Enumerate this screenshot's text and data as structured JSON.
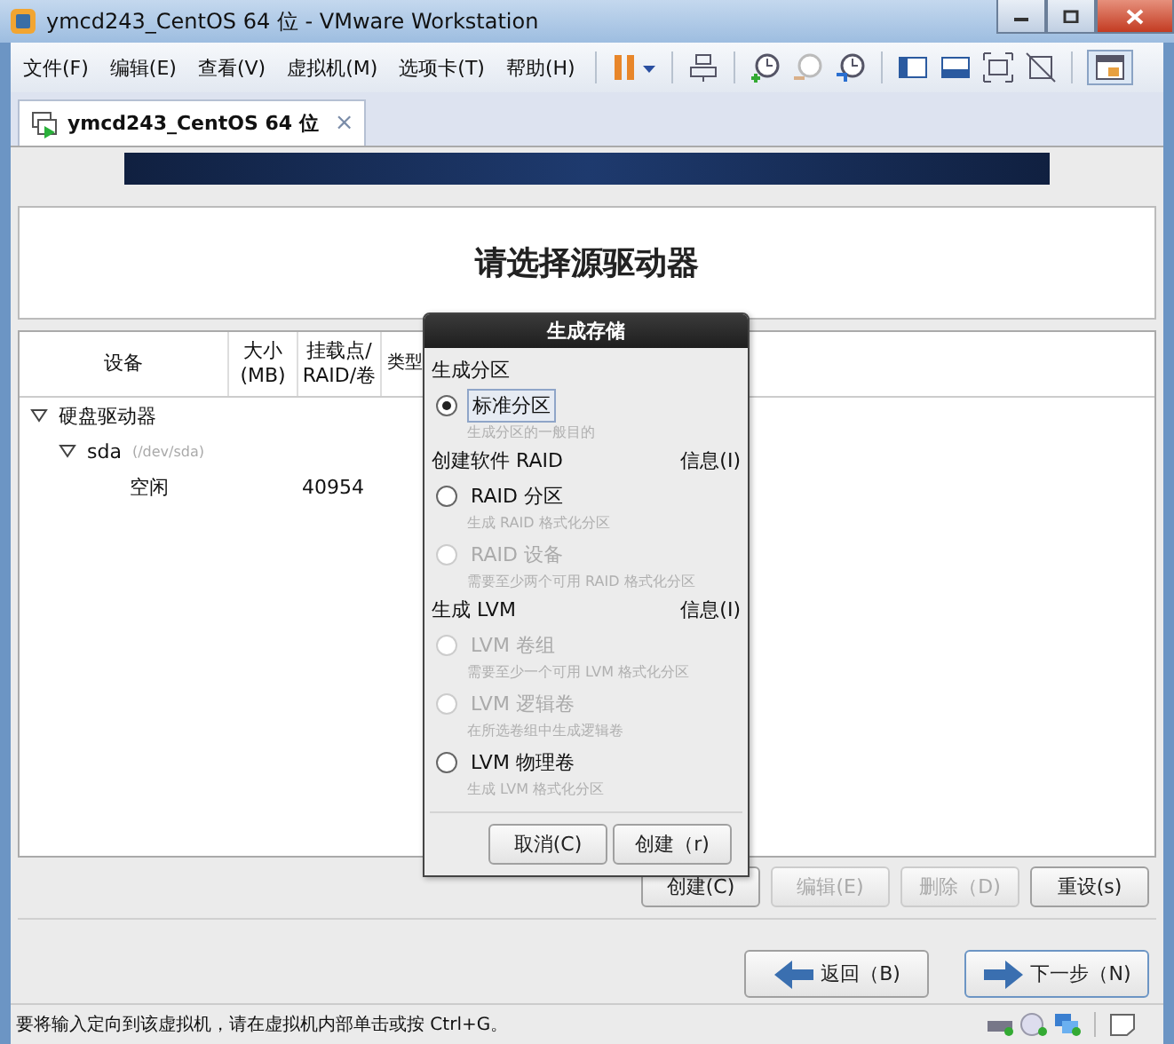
{
  "window": {
    "title": "ymcd243_CentOS 64 位 - VMware Workstation"
  },
  "menu": [
    "文件(F)",
    "编辑(E)",
    "查看(V)",
    "虚拟机(M)",
    "选项卡(T)",
    "帮助(H)"
  ],
  "tab": {
    "label": "ymcd243_CentOS 64 位",
    "close": "×"
  },
  "installer": {
    "title": "请选择源驱动器",
    "columns": [
      "设备",
      "大小\n(MB)",
      "挂载点/\nRAID/卷",
      "类型"
    ],
    "rows": [
      {
        "device": "硬盘驱动器",
        "expanded": true,
        "children": [
          {
            "device": "sda",
            "path": "(/dev/sda)",
            "expanded": true,
            "children": [
              {
                "device": "空闲",
                "size": "40954"
              }
            ]
          }
        ]
      }
    ],
    "actions": [
      {
        "label": "创建(C)",
        "disabled": false
      },
      {
        "label": "编辑(E)",
        "disabled": true
      },
      {
        "label": "删除（D)",
        "disabled": true
      },
      {
        "label": "重设(s)",
        "disabled": false
      }
    ],
    "nav": [
      {
        "label": "返回（B)",
        "kind": "back",
        "focused": false
      },
      {
        "label": "下一步（N)",
        "kind": "next",
        "focused": true
      }
    ]
  },
  "dialog": {
    "title": "生成存储",
    "sections": [
      {
        "heading": "生成分区",
        "options": [
          {
            "label": "标准分区",
            "hint": "生成分区的一般目的",
            "selected": true,
            "disabled": false
          }
        ]
      },
      {
        "heading": "创建软件 RAID",
        "info": "信息(I)",
        "options": [
          {
            "label": "RAID 分区",
            "hint": "生成 RAID 格式化分区",
            "selected": false,
            "disabled": false
          },
          {
            "label": "RAID 设备",
            "hint": "需要至少两个可用 RAID 格式化分区",
            "selected": false,
            "disabled": true
          }
        ]
      },
      {
        "heading": "生成 LVM",
        "info": "信息(I)",
        "options": [
          {
            "label": "LVM 卷组",
            "hint": "需要至少一个可用 LVM 格式化分区",
            "selected": false,
            "disabled": true
          },
          {
            "label": "LVM 逻辑卷",
            "hint": "在所选卷组中生成逻辑卷",
            "selected": false,
            "disabled": true
          },
          {
            "label": "LVM 物理卷",
            "hint": "生成 LVM 格式化分区",
            "selected": false,
            "disabled": false
          }
        ]
      }
    ],
    "buttons": [
      "取消(C)",
      "创建（r)"
    ]
  },
  "status_bar": "要将输入定向到该虚拟机，请在虚拟机内部单击或按 Ctrl+G。"
}
